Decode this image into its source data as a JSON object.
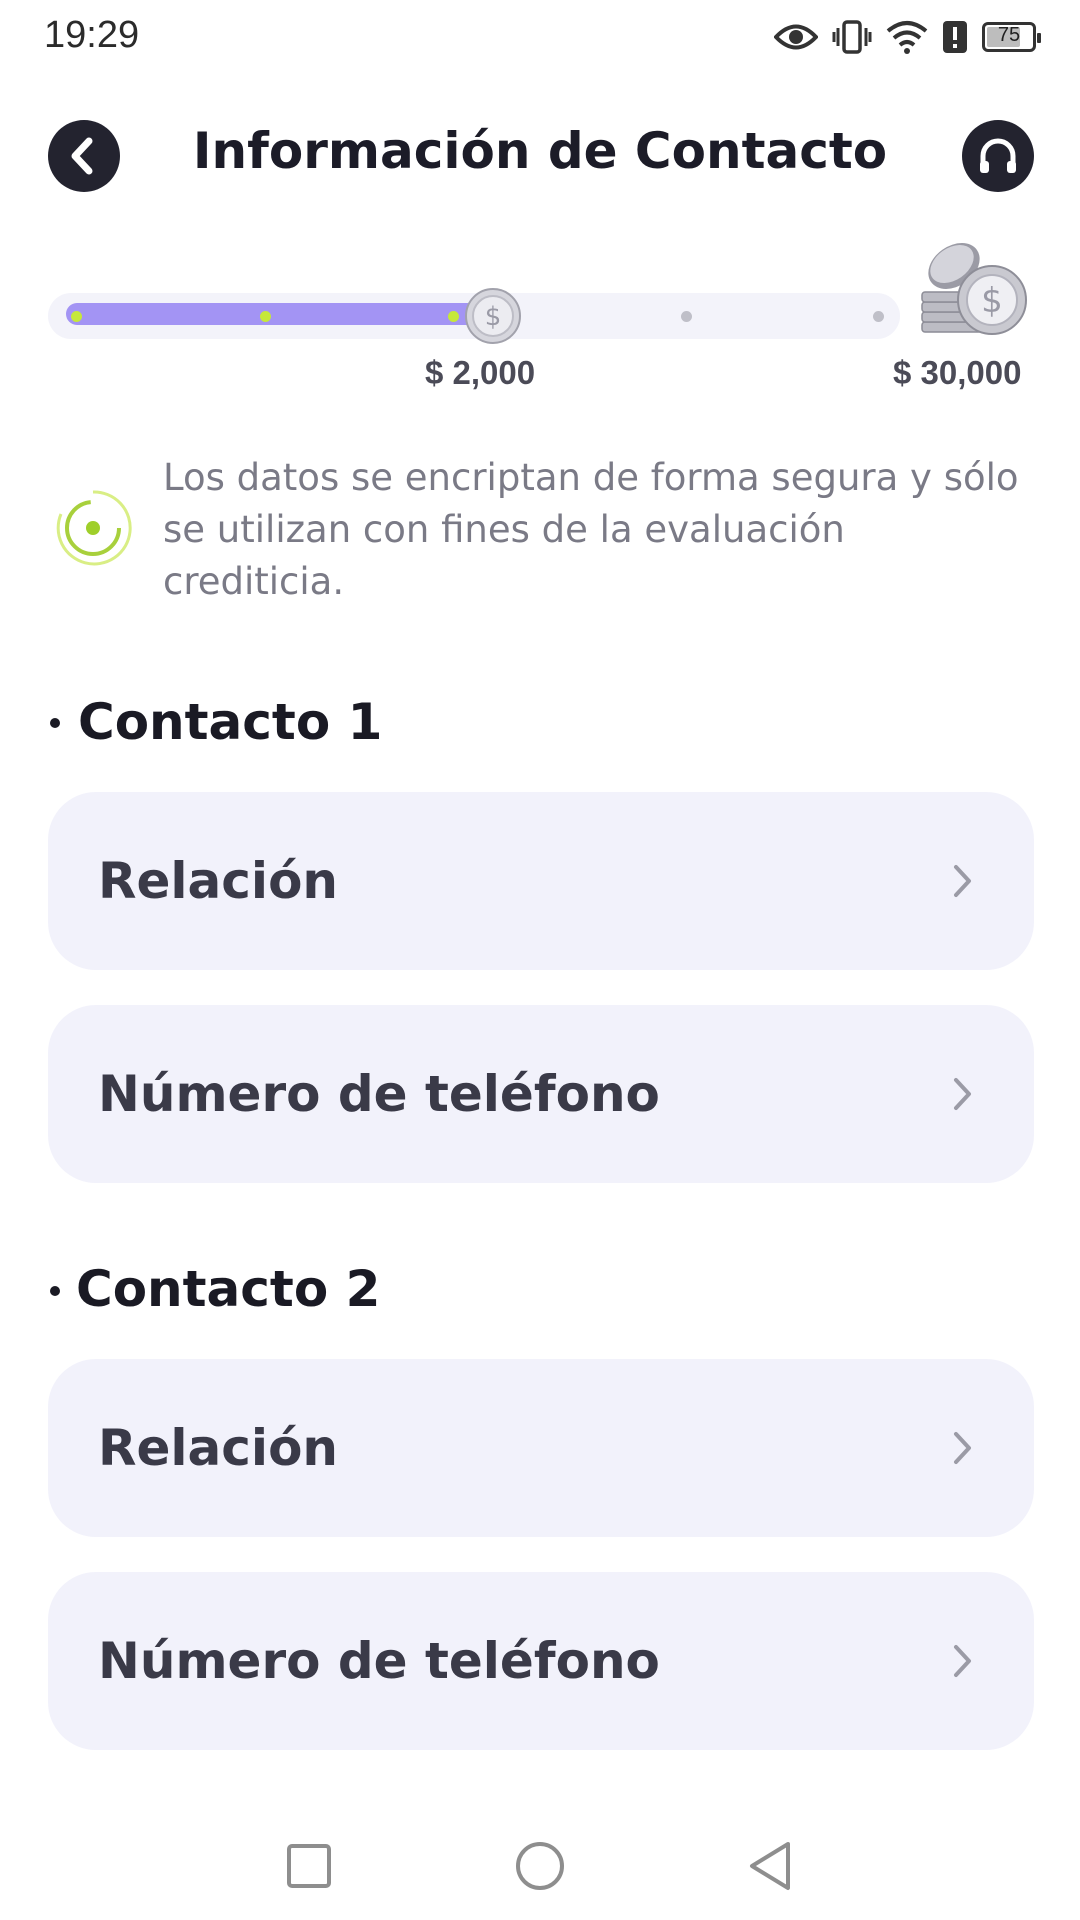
{
  "status_bar": {
    "time": "19:29",
    "battery": "75",
    "battery_level": 0.75,
    "icons": [
      "eye-icon",
      "vibrate-icon",
      "wifi-icon",
      "alert-icon",
      "battery-icon"
    ]
  },
  "header": {
    "title": "Información de Contacto",
    "back_icon": "back-arrow-icon",
    "support_icon": "headset-icon"
  },
  "progress": {
    "current_amount": "$ 2,000",
    "max_amount": "$ 30,000",
    "completed_steps": 3,
    "total_steps": 5,
    "fill_fraction": 0.52,
    "accent_color": "#a394f4",
    "step_dot_color": "#c6e83a"
  },
  "info": {
    "text": "Los datos se encriptan de forma segura y sólo se utilizan con fines de la evaluación crediticia."
  },
  "contacts": [
    {
      "title": "Contacto 1",
      "relation_label": "Relación",
      "phone_label": "Número de teléfono"
    },
    {
      "title": "Contacto 2",
      "relation_label": "Relación",
      "phone_label": "Número de teléfono"
    }
  ],
  "nav": {
    "recent_icon": "square-icon",
    "home_icon": "circle-icon",
    "back_icon": "triangle-back-icon"
  }
}
